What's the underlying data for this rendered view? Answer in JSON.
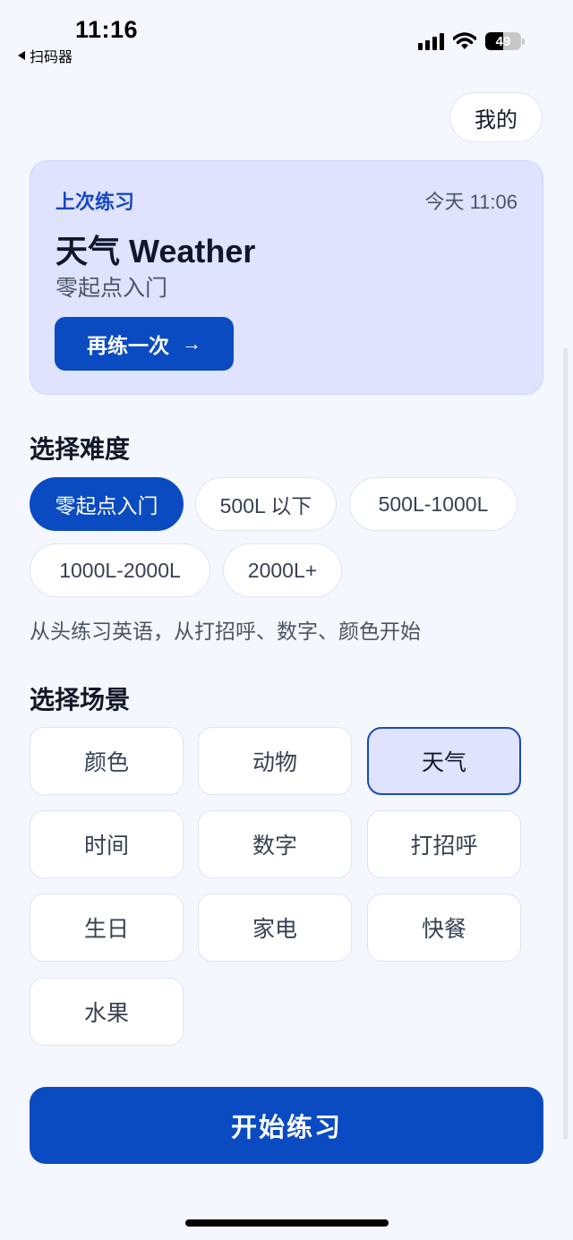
{
  "status_bar": {
    "time": "11:16",
    "back_app": "扫码器",
    "battery_level": "49",
    "battery_fraction": 0.49
  },
  "header": {
    "me_label": "我的"
  },
  "last_practice": {
    "label": "上次练习",
    "time": "今天 11:06",
    "title": "天气 Weather",
    "subtitle": "零起点入门",
    "again_label": "再练一次",
    "again_icon": "→"
  },
  "difficulty": {
    "title": "选择难度",
    "options": [
      "零起点入门",
      "500L 以下",
      "500L-1000L",
      "1000L-2000L",
      "2000L+"
    ],
    "selected": "零起点入门",
    "description": "从头练习英语，从打招呼、数字、颜色开始"
  },
  "scenes": {
    "title": "选择场景",
    "options": [
      "颜色",
      "动物",
      "天气",
      "时间",
      "数字",
      "打招呼",
      "生日",
      "家电",
      "快餐",
      "水果"
    ],
    "selected": "天气"
  },
  "start_label": "开始练习",
  "colors": {
    "primary": "#0a4bc2",
    "card_bg": "#dfe3fd",
    "page_bg": "#f5f7fe"
  }
}
